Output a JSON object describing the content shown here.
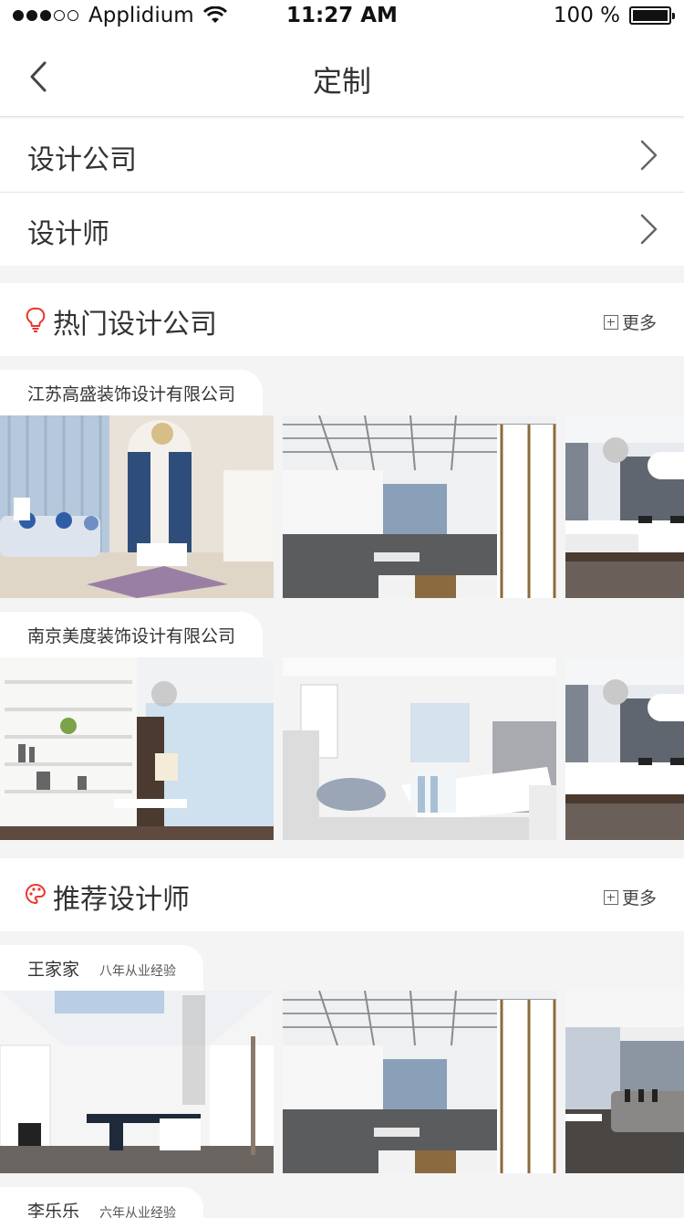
{
  "status_bar": {
    "carrier": "Applidium",
    "time": "11:27 AM",
    "battery": "100 %"
  },
  "nav": {
    "title": "定制"
  },
  "menu": [
    {
      "label": "设计公司"
    },
    {
      "label": "设计师"
    }
  ],
  "hot_companies": {
    "title": "热门设计公司",
    "more": "更多",
    "icon": "lightbulb-icon",
    "items": [
      {
        "name": "江苏高盛装饰设计有限公司"
      },
      {
        "name": "南京美度装饰设计有限公司"
      }
    ]
  },
  "recommended_designers": {
    "title": "推荐设计师",
    "more": "更多",
    "icon": "palette-icon",
    "items": [
      {
        "name": "王家家",
        "experience": "八年从业经验"
      },
      {
        "name": "李乐乐",
        "experience": "六年从业经验"
      }
    ]
  },
  "colors": {
    "accent": "#e8372b",
    "background": "#f4f4f4",
    "card": "#ffffff"
  }
}
